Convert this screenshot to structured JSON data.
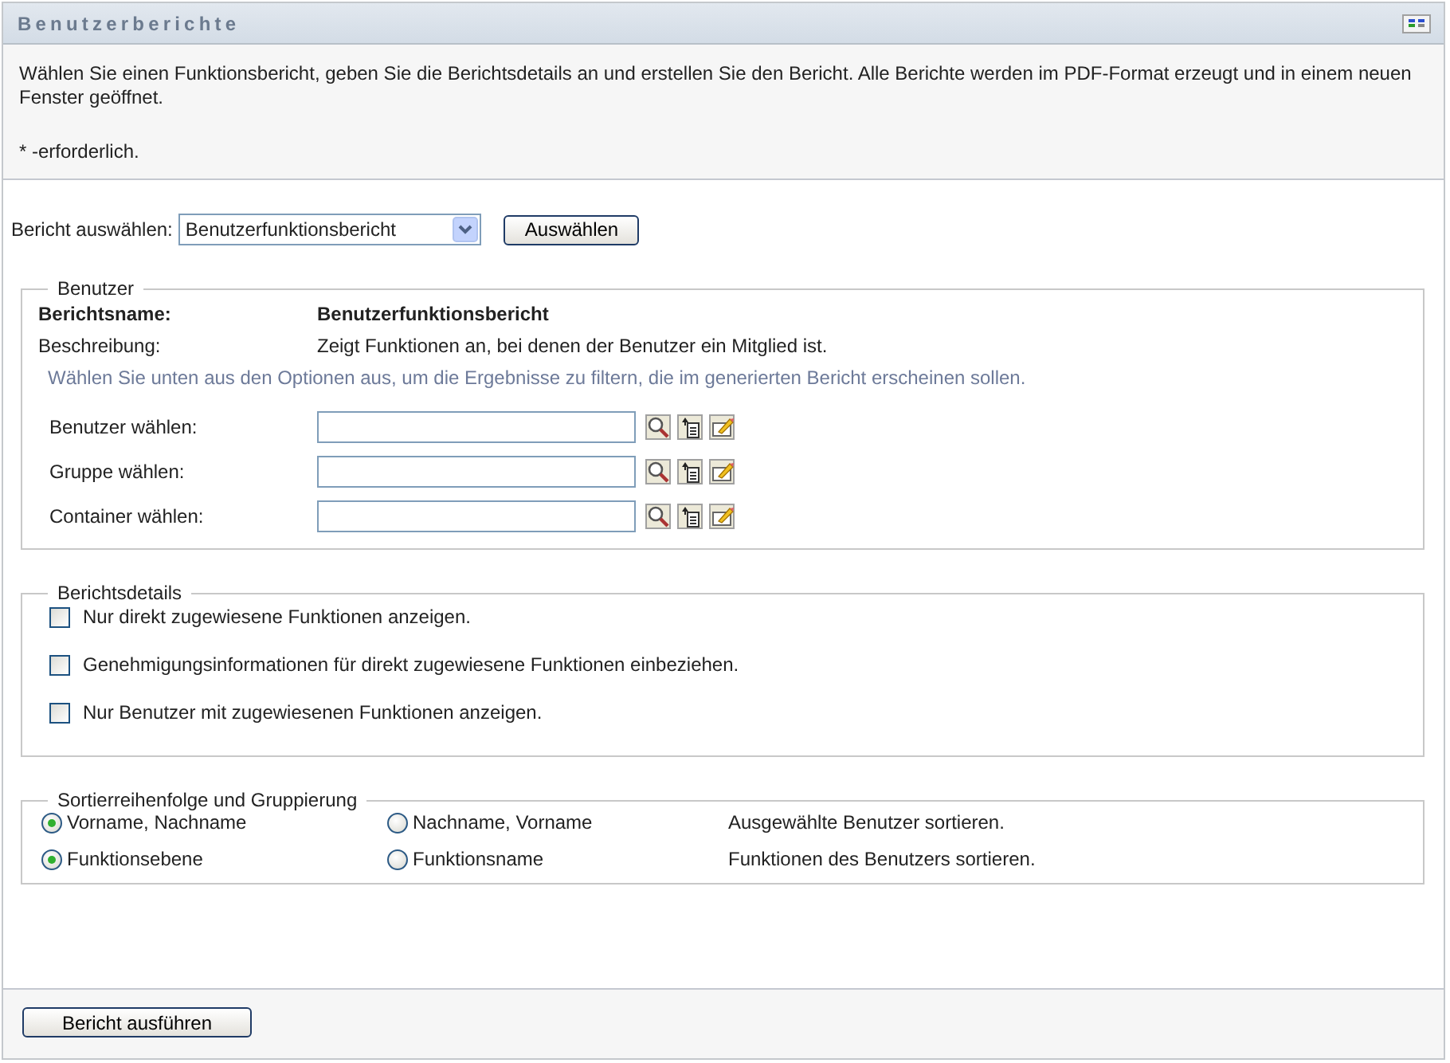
{
  "panel": {
    "title": "Benutzerberichte"
  },
  "intro": {
    "text": "Wählen Sie einen Funktionsbericht, geben Sie die Berichtsdetails an und erstellen Sie den Bericht. Alle Berichte werden im PDF-Format erzeugt und in einem neuen Fenster geöffnet.",
    "required_note": "* -erforderlich."
  },
  "report_select": {
    "label": "Bericht auswählen:",
    "value": "Benutzerfunktionsbericht",
    "button": "Auswählen"
  },
  "user_section": {
    "legend": "Benutzer",
    "name_label": "Berichtsname:",
    "name_value": "Benutzerfunktionsbericht",
    "description_label": "Beschreibung:",
    "description_value": "Zeigt Funktionen an, bei denen der Benutzer ein Mitglied ist.",
    "hint": "Wählen Sie unten aus den Optionen aus, um die Ergebnisse zu filtern, die im generierten Bericht erscheinen sollen.",
    "fields": [
      {
        "label": "Benutzer wählen:"
      },
      {
        "label": "Gruppe wählen:"
      },
      {
        "label": "Container wählen:"
      }
    ]
  },
  "details_section": {
    "legend": "Berichtsdetails",
    "options": [
      {
        "label": "Nur direkt zugewiesene Funktionen anzeigen.",
        "checked": false
      },
      {
        "label": "Genehmigungsinformationen für direkt zugewiesene Funktionen einbeziehen.",
        "checked": false
      },
      {
        "label": "Nur Benutzer mit zugewiesenen Funktionen anzeigen.",
        "checked": false
      }
    ]
  },
  "sort_section": {
    "legend": "Sortierreihenfolge und Gruppierung",
    "rows": [
      {
        "options": [
          {
            "label": "Vorname, Nachname",
            "selected": true
          },
          {
            "label": "Nachname, Vorname",
            "selected": false
          }
        ],
        "description": "Ausgewählte Benutzer sortieren."
      },
      {
        "options": [
          {
            "label": "Funktionsebene",
            "selected": true
          },
          {
            "label": "Funktionsname",
            "selected": false
          }
        ],
        "description": "Funktionen des Benutzers sortieren."
      }
    ]
  },
  "run_button": "Bericht ausführen"
}
